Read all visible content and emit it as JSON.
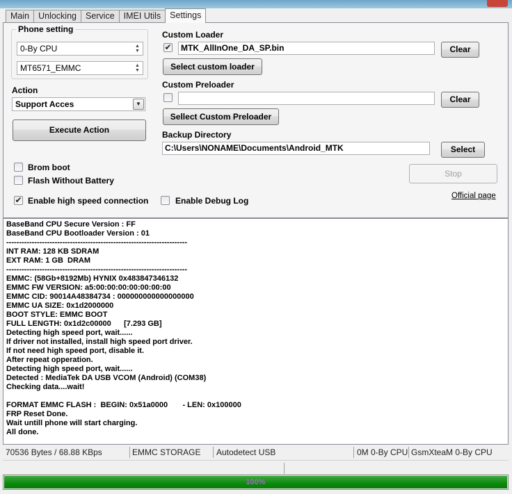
{
  "tabs": [
    {
      "label": "Main"
    },
    {
      "label": "Unlocking"
    },
    {
      "label": "Service"
    },
    {
      "label": "IMEI Utils"
    },
    {
      "label": "Settings"
    }
  ],
  "active_tab": "Settings",
  "phone_setting": {
    "title": "Phone setting",
    "cpu_select": "0-By CPU",
    "model_select": "MT6571_EMMC"
  },
  "action": {
    "label": "Action",
    "select": "Support Acces",
    "execute_button": "Execute Action"
  },
  "checks": {
    "brom_boot": {
      "label": "Brom boot",
      "checked": false
    },
    "flash_without_battery": {
      "label": "Flash Without Battery",
      "checked": false
    },
    "high_speed": {
      "label": "Enable high speed connection",
      "checked": true
    },
    "debug_log": {
      "label": "Enable Debug Log",
      "checked": false
    }
  },
  "custom_loader": {
    "label": "Custom Loader",
    "checked": true,
    "value": "MTK_AllInOne_DA_SP.bin",
    "clear_button": "Clear",
    "select_button": "Select custom loader"
  },
  "custom_preloader": {
    "label": "Custom Preloader",
    "checked": false,
    "value": "",
    "clear_button": "Clear",
    "select_button": "Sellect Custom Preloader"
  },
  "backup": {
    "label": "Backup Directory",
    "value": "C:\\Users\\NONAME\\Documents\\Android_MTK",
    "select_button": "Select"
  },
  "stop_button": "Stop",
  "official_page_link": "Official page",
  "log_lines": [
    "BaseBand CPU Secure Version : FF",
    "BaseBand CPU Bootloader Version : 01",
    "-----------------------------------------------------------------------",
    "INT RAM: 128 KB SDRAM",
    "EXT RAM: 1 GB  DRAM",
    "-----------------------------------------------------------------------",
    "EMMC: (58Gb+8192Mb) HYNIX 0x483847346132",
    "EMMC FW VERSION: a5:00:00:00:00:00:00:00",
    "EMMC CID: 90014A48384734 : 000000000000000000",
    "EMMC UA SIZE: 0x1d2000000",
    "BOOT STYLE: EMMC BOOT",
    "FULL LENGTH: 0x1d2c00000      [7.293 GB]",
    "Detecting high speed port, wait......",
    "If driver not installed, install high speed port driver.",
    "If not need high speed port, disable it.",
    "After repeat opperation.",
    "Detecting high speed port, wait......",
    "Detected : MediaTek DA USB VCOM (Android) (COM38)",
    "Checking data....wait!",
    "",
    "FORMAT EMMC FLASH :  BEGIN: 0x51a0000       - LEN: 0x100000",
    "FRP Reset Done.",
    "Wait untill phone will start charging.",
    "All done."
  ],
  "status": {
    "transfer": "70536 Bytes / 68.88 KBps",
    "storage": "EMMC STORAGE",
    "usb": "Autodetect USB",
    "cpu_info": "0M 0-By CPU",
    "brand": "GsmXteaM 0-By CPU"
  },
  "progress": {
    "value": 1.0,
    "label": "100%"
  },
  "colors": {
    "progress": "#0c8a0c",
    "progress_text": "#b45bd8"
  }
}
